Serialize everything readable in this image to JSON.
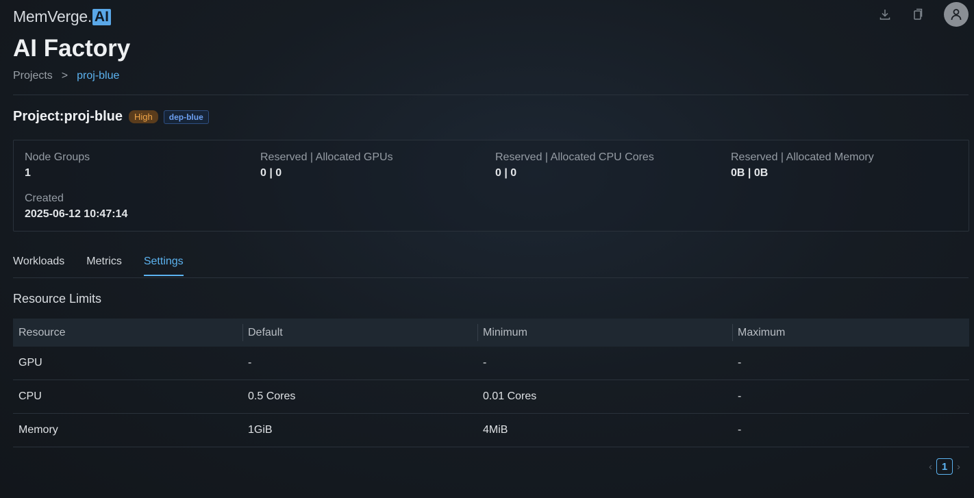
{
  "brand": {
    "name": "MemVerge.",
    "ai": "AI"
  },
  "header": {
    "icons": [
      "download-icon",
      "copy-icon",
      "user-icon"
    ]
  },
  "page": {
    "title": "AI Factory"
  },
  "breadcrumb": {
    "root": "Projects",
    "separator": ">",
    "current": "proj-blue"
  },
  "project": {
    "title": "Project:proj-blue",
    "priority": "High",
    "department": "dep-blue",
    "colors": {
      "priority_bg": "#5a3c1c",
      "priority_fg": "#f0a548",
      "dept_fg": "#6c9ff0"
    }
  },
  "summary": {
    "node_groups": {
      "label": "Node Groups",
      "value": "1"
    },
    "gpus": {
      "label": "Reserved | Allocated GPUs",
      "value": "0 | 0"
    },
    "cpu": {
      "label": "Reserved | Allocated CPU Cores",
      "value": "0 | 0"
    },
    "memory": {
      "label": "Reserved | Allocated Memory",
      "value": "0B | 0B"
    },
    "created": {
      "label": "Created",
      "value": "2025-06-12 10:47:14"
    }
  },
  "tabs": [
    {
      "label": "Workloads",
      "active": false
    },
    {
      "label": "Metrics",
      "active": false
    },
    {
      "label": "Settings",
      "active": true
    }
  ],
  "resource_limits": {
    "title": "Resource Limits",
    "columns": [
      "Resource",
      "Default",
      "Minimum",
      "Maximum"
    ],
    "rows": [
      [
        "GPU",
        "-",
        "-",
        "-"
      ],
      [
        "CPU",
        "0.5 Cores",
        "0.01 Cores",
        "-"
      ],
      [
        "Memory",
        "1GiB",
        "4MiB",
        "-"
      ]
    ]
  },
  "pagination": {
    "prev": "‹",
    "current": "1",
    "next": "›"
  },
  "accent_color": "#5cb3f0"
}
